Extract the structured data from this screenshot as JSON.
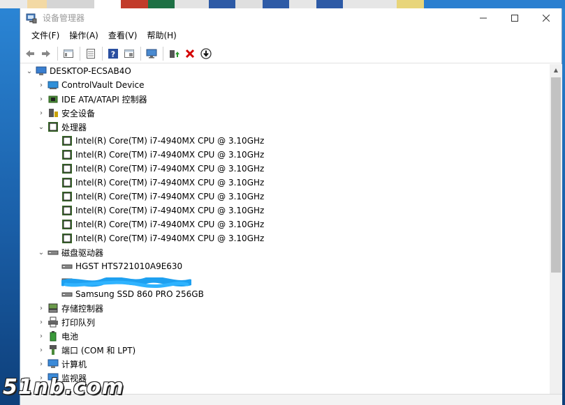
{
  "window": {
    "title": "设备管理器"
  },
  "menu": [
    "文件(F)",
    "操作(A)",
    "查看(V)",
    "帮助(H)"
  ],
  "toolbar": [
    "back-icon",
    "forward-icon",
    "properties-view-icon",
    "list-view-icon",
    "help-icon",
    "device-view-icon",
    "monitor-scan-icon",
    "update-driver-icon",
    "uninstall-icon",
    "download-icon"
  ],
  "tree": {
    "root": "DESKTOP-ECSAB4O",
    "categories": [
      {
        "label": "ControlVault Device",
        "icon": "controlvault-icon",
        "expanded": false
      },
      {
        "label": "IDE ATA/ATAPI 控制器",
        "icon": "ide-controller-icon",
        "expanded": false
      },
      {
        "label": "安全设备",
        "icon": "security-device-icon",
        "expanded": false
      },
      {
        "label": "处理器",
        "icon": "processor-icon",
        "expanded": true,
        "children": [
          "Intel(R) Core(TM) i7-4940MX CPU @ 3.10GHz",
          "Intel(R) Core(TM) i7-4940MX CPU @ 3.10GHz",
          "Intel(R) Core(TM) i7-4940MX CPU @ 3.10GHz",
          "Intel(R) Core(TM) i7-4940MX CPU @ 3.10GHz",
          "Intel(R) Core(TM) i7-4940MX CPU @ 3.10GHz",
          "Intel(R) Core(TM) i7-4940MX CPU @ 3.10GHz",
          "Intel(R) Core(TM) i7-4940MX CPU @ 3.10GHz",
          "Intel(R) Core(TM) i7-4940MX CPU @ 3.10GHz"
        ]
      },
      {
        "label": "磁盘驱动器",
        "icon": "disk-drive-icon",
        "expanded": true,
        "children": [
          "HGST HTS721010A9E630",
          "",
          "Samsung SSD 860 PRO 256GB"
        ]
      },
      {
        "label": "存储控制器",
        "icon": "storage-controller-icon",
        "expanded": false
      },
      {
        "label": "打印队列",
        "icon": "print-queue-icon",
        "expanded": false
      },
      {
        "label": "电池",
        "icon": "battery-icon",
        "expanded": false
      },
      {
        "label": "端口 (COM 和 LPT)",
        "icon": "port-icon",
        "expanded": false
      },
      {
        "label": "计算机",
        "icon": "computer-icon",
        "expanded": false
      },
      {
        "label": "监视器",
        "icon": "monitor-icon",
        "expanded": false
      }
    ]
  },
  "watermark": "51nb.com",
  "colors": {
    "accent": "#1f6fb5",
    "chip": "#3a6a2a",
    "delete": "#d40000"
  }
}
